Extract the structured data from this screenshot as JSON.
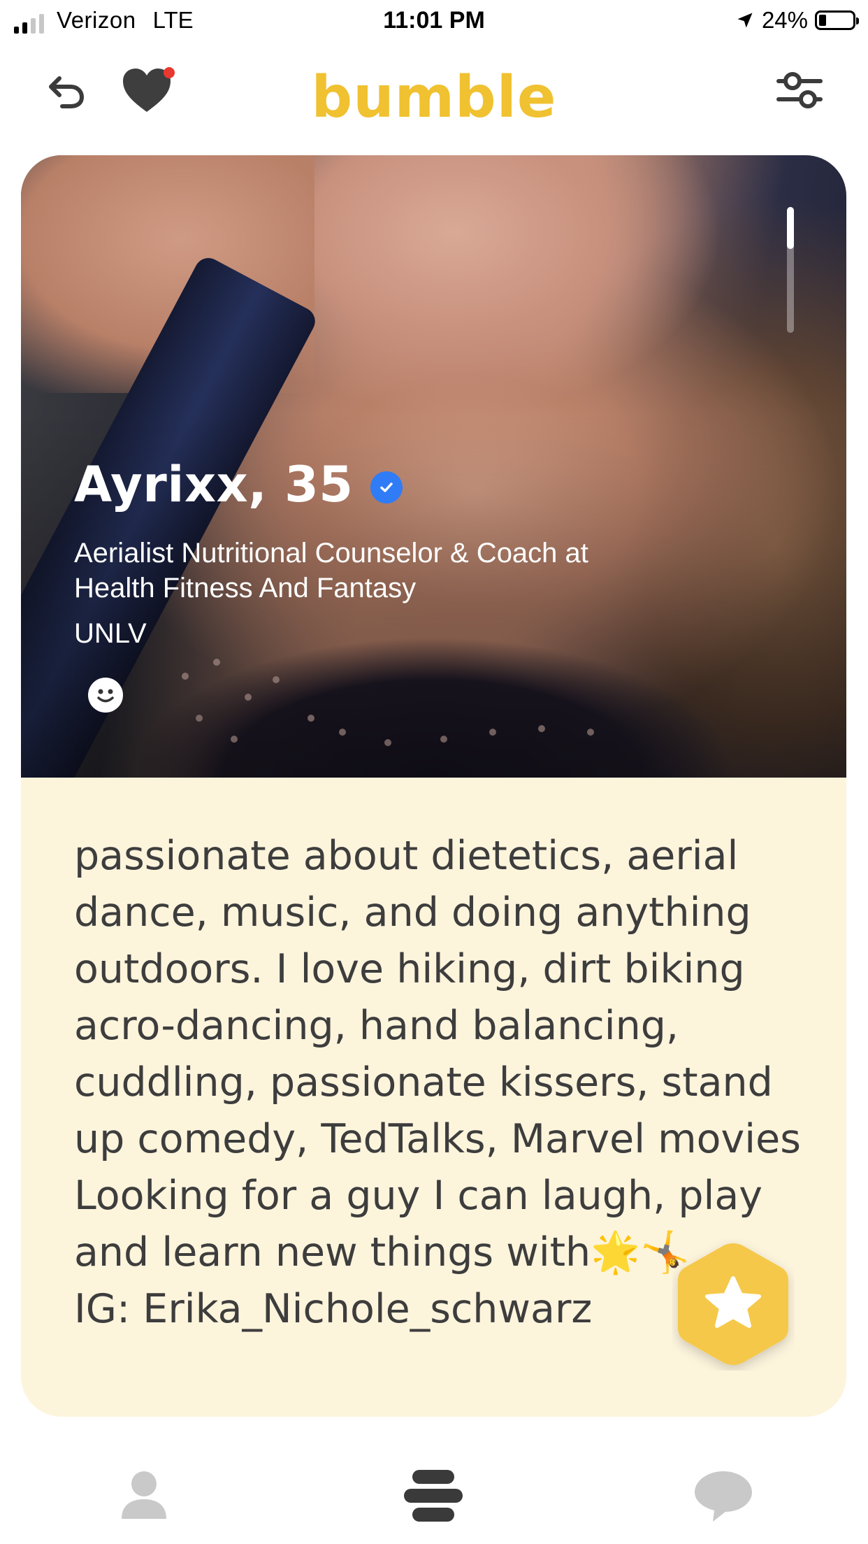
{
  "status_bar": {
    "carrier": "Verizon",
    "network": "LTE",
    "time": "11:01 PM",
    "battery_percent": "24%",
    "signal_bars": 2
  },
  "header": {
    "brand": "bumble",
    "back_icon": "undo-icon",
    "likes_icon": "heart-icon",
    "filter_icon": "filter-sliders-icon",
    "brand_color": "#f0c130",
    "notification_dot_color": "#e8382f"
  },
  "profile": {
    "name_age": "Ayrixx, 35",
    "verified_icon": "verified-check-icon",
    "job": "Aerialist Nutritional Counselor & Coach at Health Fitness And Fantasy",
    "school": "UNLV",
    "mood_icon": "smiley-icon",
    "bio": "passionate about dietetics, aerial dance, music, and doing anything outdoors. I love hiking, dirt biking acro-dancing, hand balancing, cuddling, passionate kissers, stand up comedy, TedTalks, Marvel movies\nLooking for a guy I can laugh, play and learn new things with🌟🤸\nIG: Erika_Nichole_schwarz",
    "photo_count_indicator": "1 of 3"
  },
  "actions": {
    "superswipe_icon": "star-icon",
    "superswipe_color": "#f5c84a"
  },
  "bottom_nav": {
    "profile_icon": "profile-icon",
    "discover_icon": "discover-icon",
    "chat_icon": "chat-icon"
  }
}
